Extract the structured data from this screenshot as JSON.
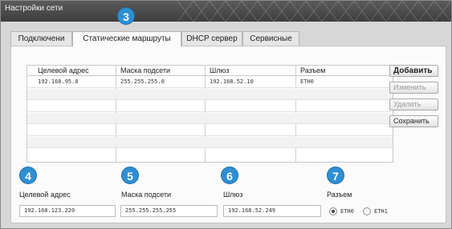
{
  "window": {
    "title": "Настройки сети"
  },
  "badges": {
    "tab": "3",
    "dest": "4",
    "mask": "5",
    "gateway": "6",
    "port": "7"
  },
  "tabs": [
    {
      "label": "Подключени"
    },
    {
      "label": "Статические маршруты",
      "active": true
    },
    {
      "label": "DHCP сервер"
    },
    {
      "label": "Сервисные"
    }
  ],
  "table": {
    "headers": [
      "Целевой адрес",
      "Маска подсети",
      "Шлюз",
      "Разъем"
    ],
    "rows": [
      [
        "192.168.95.0",
        "255.255.255.0",
        "192.168.52.10",
        "ETH0"
      ]
    ]
  },
  "buttons": {
    "add": "Добавить",
    "edit": "Изменить",
    "delete": "Удалить",
    "save": "Сохранить"
  },
  "form": {
    "dest_label": "Целевой адрес",
    "dest_value": "192.168.123.220",
    "mask_label": "Маска подсети",
    "mask_value": "255.255.255.255",
    "gateway_label": "Шлюз",
    "gateway_value": "192.168.52.249",
    "port_label": "Разъем",
    "port_options": [
      "ETH0",
      "ETH1"
    ],
    "port_selected": "ETH0"
  },
  "colors": {
    "badge": "#2f8fd3",
    "titlebar": "#4a4a4a"
  }
}
